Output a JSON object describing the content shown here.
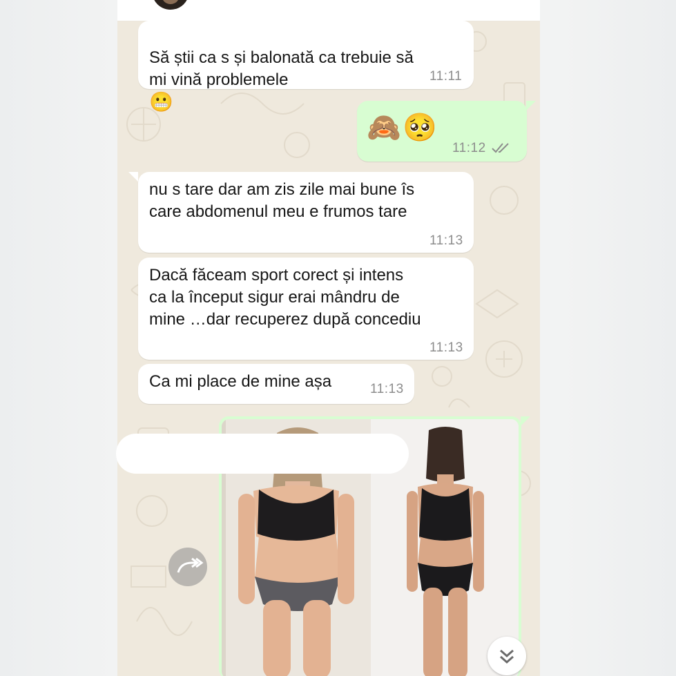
{
  "chat": {
    "messages": [
      {
        "direction": "in",
        "text": "Să știi ca s și balonată ca trebuie să\nmi vină problemele",
        "emoji": "😬",
        "time": "11:11"
      },
      {
        "direction": "out",
        "emojis": [
          "🙈",
          "🥺"
        ],
        "time": "11:12",
        "status": "read-ticks-icon"
      },
      {
        "direction": "in",
        "text": "nu s tare  dar am zis zile mai bune îs\ncare abdomenul meu e frumos tare",
        "time": "11:13"
      },
      {
        "direction": "in",
        "text": "Dacă făceam sport corect și intens\nca la început sigur erai mândru de\nmine …dar recuperez după concediu",
        "time": "11:13"
      },
      {
        "direction": "in",
        "text": "Ca mi place de mine așa",
        "time": "11:13"
      },
      {
        "direction": "out",
        "type": "image",
        "icon": "before-after-photo"
      }
    ]
  },
  "icons": {
    "forward": "forward-icon",
    "scroll_down": "double-chevron-down-icon",
    "ticks": "double-check-icon"
  },
  "colors": {
    "wallpaper": "#efe9dd",
    "incoming_bubble": "#ffffff",
    "outgoing_bubble": "#d8fdd2",
    "time_text": "#8c8c8c"
  }
}
